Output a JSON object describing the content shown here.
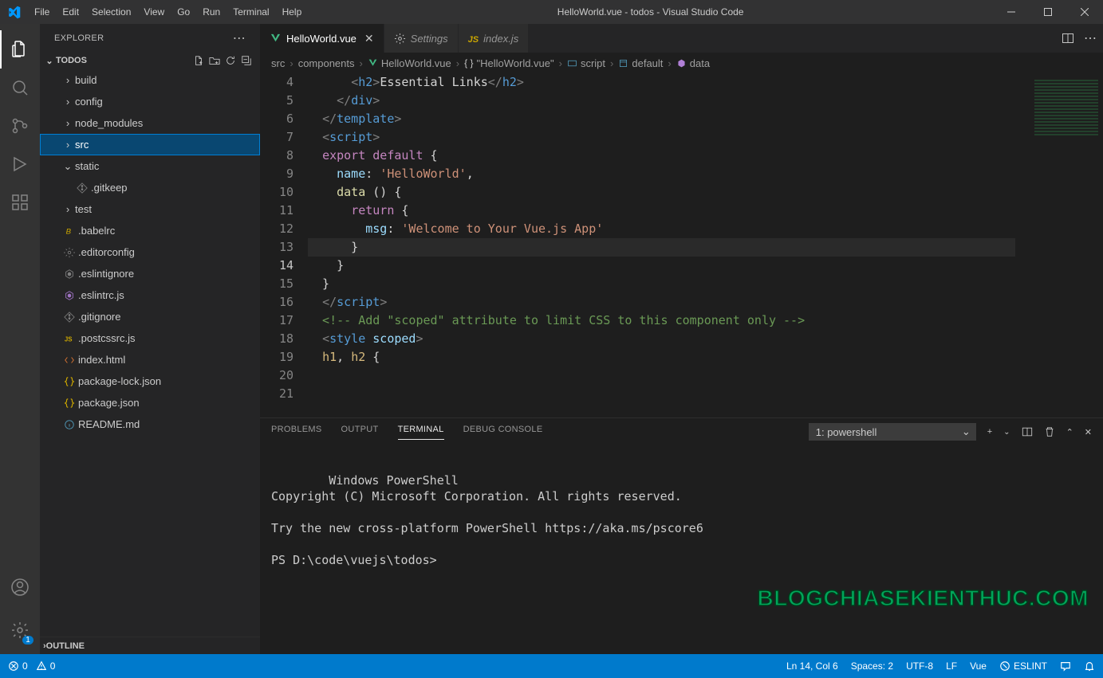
{
  "title": "HelloWorld.vue - todos - Visual Studio Code",
  "menu": [
    "File",
    "Edit",
    "Selection",
    "View",
    "Go",
    "Run",
    "Terminal",
    "Help"
  ],
  "sidebar": {
    "header": "EXPLORER",
    "section": "TODOS",
    "outline": "OUTLINE",
    "tree": [
      {
        "type": "folder",
        "label": "build",
        "depth": 1
      },
      {
        "type": "folder",
        "label": "config",
        "depth": 1
      },
      {
        "type": "folder",
        "label": "node_modules",
        "depth": 1
      },
      {
        "type": "folder",
        "label": "src",
        "depth": 1,
        "selected": true
      },
      {
        "type": "folder",
        "label": "static",
        "depth": 1,
        "open": true
      },
      {
        "type": "file",
        "label": ".gitkeep",
        "depth": 2,
        "iconColor": "ico-gray",
        "icon": "git"
      },
      {
        "type": "folder",
        "label": "test",
        "depth": 1
      },
      {
        "type": "file",
        "label": ".babelrc",
        "depth": 1,
        "iconColor": "ico-yellow",
        "icon": "babel"
      },
      {
        "type": "file",
        "label": ".editorconfig",
        "depth": 1,
        "iconColor": "ico-gray",
        "icon": "gear"
      },
      {
        "type": "file",
        "label": ".eslintignore",
        "depth": 1,
        "iconColor": "ico-gray",
        "icon": "eslint"
      },
      {
        "type": "file",
        "label": ".eslintrc.js",
        "depth": 1,
        "iconColor": "ico-purple",
        "icon": "eslint"
      },
      {
        "type": "file",
        "label": ".gitignore",
        "depth": 1,
        "iconColor": "ico-gray",
        "icon": "git"
      },
      {
        "type": "file",
        "label": ".postcssrc.js",
        "depth": 1,
        "iconColor": "ico-yellow",
        "icon": "js"
      },
      {
        "type": "file",
        "label": "index.html",
        "depth": 1,
        "iconColor": "ico-orange",
        "icon": "html"
      },
      {
        "type": "file",
        "label": "package-lock.json",
        "depth": 1,
        "iconColor": "ico-yellow",
        "icon": "json"
      },
      {
        "type": "file",
        "label": "package.json",
        "depth": 1,
        "iconColor": "ico-yellow",
        "icon": "json"
      },
      {
        "type": "file",
        "label": "README.md",
        "depth": 1,
        "iconColor": "ico-blue",
        "icon": "info"
      }
    ]
  },
  "tabs": [
    {
      "label": "HelloWorld.vue",
      "active": true,
      "iconColor": "ico-green",
      "close": true
    },
    {
      "label": "Settings",
      "active": false,
      "iconColor": "",
      "icon": "gear"
    },
    {
      "label": "index.js",
      "active": false,
      "iconColor": "ico-yellow",
      "icon": "js"
    }
  ],
  "breadcrumbs": [
    {
      "label": "src"
    },
    {
      "label": "components"
    },
    {
      "label": "HelloWorld.vue",
      "iconColor": "ico-green",
      "icon": "vue"
    },
    {
      "label": "\"HelloWorld.vue\"",
      "icon": "braces"
    },
    {
      "label": "script",
      "icon": "module",
      "iconColor": "ico-blue"
    },
    {
      "label": "default",
      "icon": "var",
      "iconColor": "ico-blue"
    },
    {
      "label": "data",
      "icon": "method",
      "iconColor": "ico-purple"
    }
  ],
  "code": {
    "startLine": 4,
    "currentLine": 14,
    "lines": [
      "      <h2>Essential Links</h2>",
      "    </div>",
      "  </template>",
      "",
      "  <script>",
      "  export default {",
      "    name: 'HelloWorld',",
      "    data () {",
      "      return {",
      "        msg: 'Welcome to Your Vue.js App'",
      "      }",
      "    }",
      "  }",
      "  </script>",
      "",
      "  <!-- Add \"scoped\" attribute to limit CSS to this component only -->",
      "  <style scoped>",
      "  h1, h2 {"
    ]
  },
  "panel": {
    "tabs": [
      "PROBLEMS",
      "OUTPUT",
      "TERMINAL",
      "DEBUG CONSOLE"
    ],
    "active": "TERMINAL",
    "terminalSelect": "1: powershell",
    "terminalBody": "Windows PowerShell\nCopyright (C) Microsoft Corporation. All rights reserved.\n\nTry the new cross-platform PowerShell https://aka.ms/pscore6\n\nPS D:\\code\\vuejs\\todos>"
  },
  "status": {
    "errors": "0",
    "warnings": "0",
    "lncol": "Ln 14, Col 6",
    "spaces": "Spaces: 2",
    "encoding": "UTF-8",
    "eol": "LF",
    "lang": "Vue",
    "eslint": "ESLINT"
  },
  "watermark": "BLOGCHIASEKIENTHUC.COM",
  "settingsBadge": "1"
}
